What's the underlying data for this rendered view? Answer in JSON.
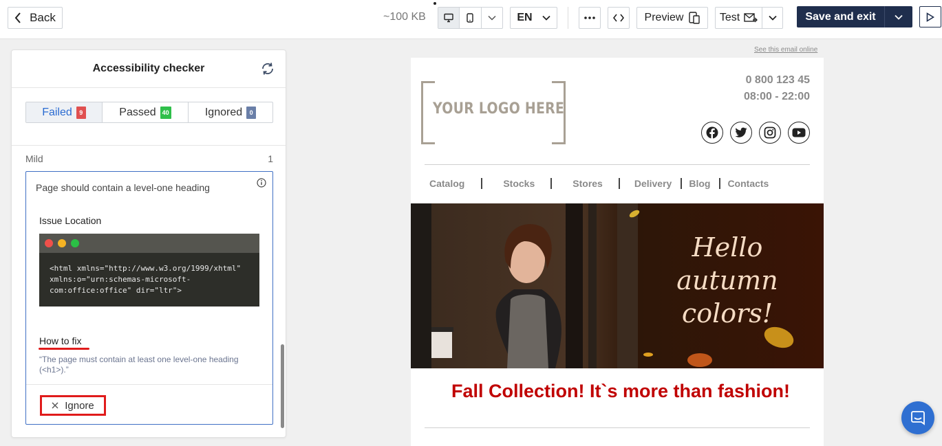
{
  "toolbar": {
    "back_label": "Back",
    "size_label": "~100 KB",
    "language": "EN",
    "preview_label": "Preview",
    "test_label": "Test",
    "save_label": "Save and exit"
  },
  "checker": {
    "title": "Accessibility checker",
    "tabs": [
      {
        "label": "Failed",
        "count": "9",
        "color": "#e05050",
        "active": true
      },
      {
        "label": "Passed",
        "count": "40",
        "color": "#2fbf4a",
        "active": false
      },
      {
        "label": "Ignored",
        "count": "0",
        "color": "#6a7fa8",
        "active": false
      }
    ],
    "section_label": "Mild",
    "section_count": "1",
    "issue": {
      "title": "Page should contain a level-one heading",
      "location_label": "Issue Location",
      "code": "<html xmlns=\"http://www.w3.org/1999/xhtml\"\nxmlns:o=\"urn:schemas-microsoft-\ncom:office:office\" dir=\"ltr\">",
      "fix_label": "How to fix",
      "fix_text": "“The page must contain at least one level-one heading (<h1>).”",
      "ignore_label": "Ignore"
    }
  },
  "email": {
    "see_online": "See this email online",
    "logo_text": "YOUR LOGO HERE",
    "phone": "0 800 123 45",
    "hours": "08:00 - 22:00",
    "socials": [
      "facebook-icon",
      "twitter-icon",
      "instagram-icon",
      "youtube-icon"
    ],
    "nav": [
      "Catalog",
      "Stocks",
      "Stores",
      "Delivery",
      "Blog",
      "Contacts"
    ],
    "hero_line1": "Hello",
    "hero_line2": "autumn",
    "hero_line3": "colors!",
    "headline": "Fall Collection! It`s more than fashion!"
  }
}
